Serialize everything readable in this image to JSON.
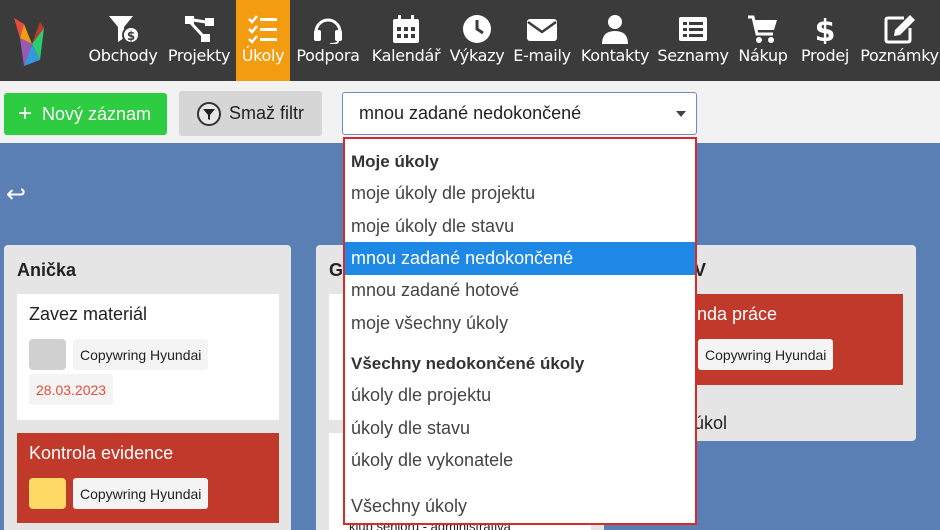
{
  "nav": {
    "items": [
      {
        "key": "obchody",
        "label": "Obchody",
        "icon": "money-filter-icon"
      },
      {
        "key": "projekty",
        "label": "Projekty",
        "icon": "sitemap-icon"
      },
      {
        "key": "ukoly",
        "label": "Úkoly",
        "icon": "tasks-icon",
        "active": true
      },
      {
        "key": "podpora",
        "label": "Podpora",
        "icon": "headset-icon"
      },
      {
        "key": "kalendar",
        "label": "Kalendář",
        "icon": "calendar-icon"
      },
      {
        "key": "vykazy",
        "label": "Výkazy",
        "icon": "clock-icon"
      },
      {
        "key": "emaily",
        "label": "E-maily",
        "icon": "envelope-icon"
      },
      {
        "key": "kontakty",
        "label": "Kontakty",
        "icon": "user-icon"
      },
      {
        "key": "seznamy",
        "label": "Seznamy",
        "icon": "list-icon"
      },
      {
        "key": "nakup",
        "label": "Nákup",
        "icon": "cart-icon"
      },
      {
        "key": "prodej",
        "label": "Prodej",
        "icon": "dollar-icon"
      },
      {
        "key": "poznamky",
        "label": "Poznámky",
        "icon": "edit-icon"
      }
    ]
  },
  "toolbar": {
    "new_label": "Nový záznam",
    "clear_label": "Smaž filtr",
    "filter_value": "mnou zadané nedokončené"
  },
  "board": {
    "columns": [
      {
        "title": "Anička",
        "cards": [
          {
            "title": "Zavez materiál",
            "tag": "Copywring Hyundai",
            "date": "28.03.2023",
            "avatar_color": "#d0d0d0",
            "color": "white"
          },
          {
            "title": "Kontrola evidence",
            "tag": "Copywring Hyundai",
            "avatar_color": "#ffd966",
            "color": "red"
          }
        ]
      },
      {
        "title": "G",
        "cards": [
          {
            "title": "",
            "color": "white"
          },
          {
            "title": "",
            "partial_text": "klub seniorů - administrativa",
            "color": "white"
          }
        ]
      },
      {
        "title": "V",
        "cards": [
          {
            "title": "nda práce",
            "tag": "Copywring Hyundai",
            "color": "red"
          },
          {
            "title": "úkol",
            "color": "plain"
          }
        ]
      }
    ]
  },
  "dropdown": {
    "groups": [
      {
        "label": "Moje úkoly",
        "items": [
          "moje úkoly dle projektu",
          "moje úkoly dle stavu",
          "mnou zadané nedokončené",
          "mnou zadané hotové",
          "moje všechny úkoly"
        ]
      },
      {
        "label": "Všechny nedokončené úkoly",
        "items": [
          "úkoly dle projektu",
          "úkoly dle stavu",
          "úkoly dle vykonatele"
        ]
      }
    ],
    "extra_item": "Všechny úkoly",
    "selected": "mnou zadané nedokončené"
  },
  "colors": {
    "nav_bg": "#3b3b3b",
    "active": "#f39c12",
    "green": "#2ecc40",
    "board_bg": "#5a7fb5",
    "red_card": "#c0392b",
    "dropdown_border": "#d62b2b",
    "selected_bg": "#1e88e5"
  }
}
